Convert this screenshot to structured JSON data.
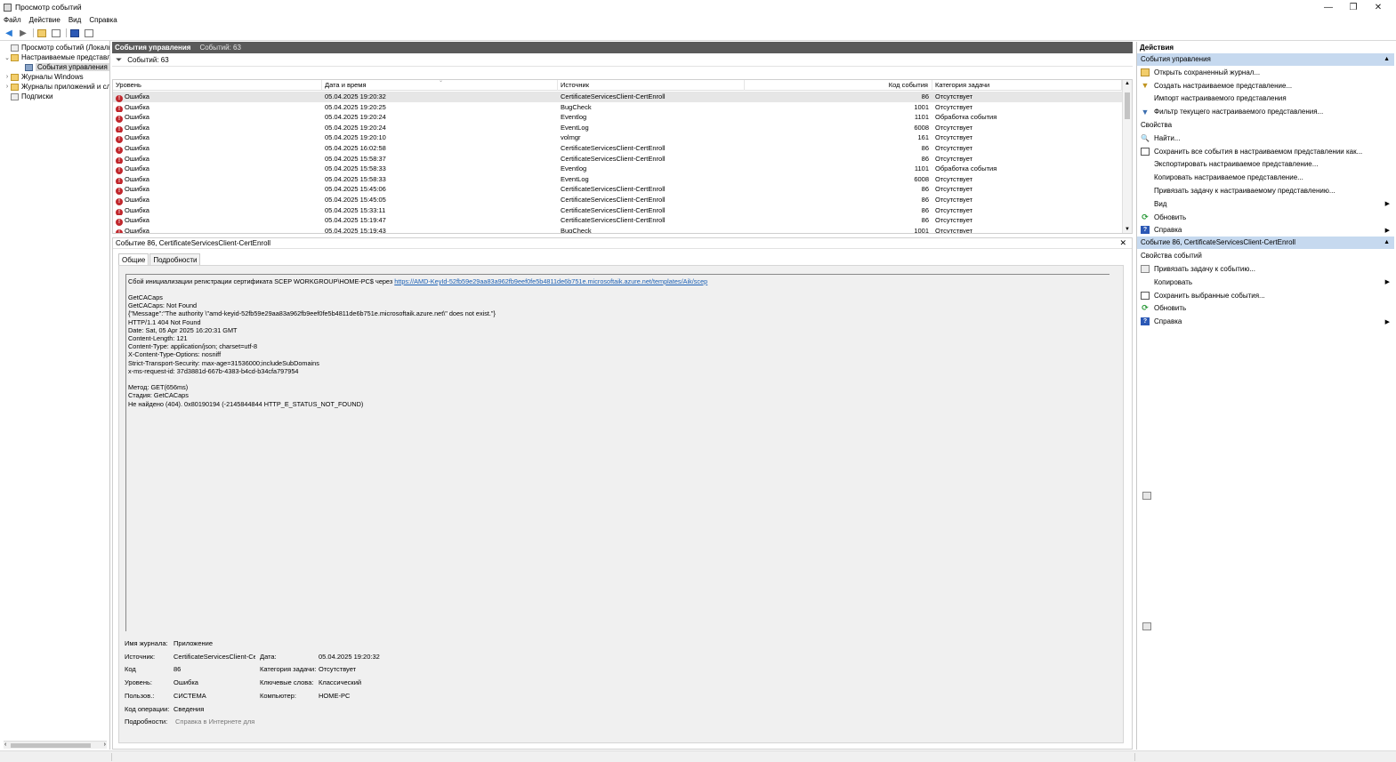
{
  "window": {
    "title": "Просмотр событий",
    "controls": [
      "—",
      "❐",
      "✕"
    ]
  },
  "menu": [
    "Файл",
    "Действие",
    "Вид",
    "Справка"
  ],
  "tree": {
    "items": [
      {
        "label": "Просмотр событий (Локальный)",
        "expander": "",
        "icon": "event-viewer-icon"
      },
      {
        "label": "Настраиваемые представления",
        "expander": "⌄",
        "icon": "folder-icon"
      },
      {
        "label": "События управления",
        "expander": "",
        "icon": "filter-icon"
      },
      {
        "label": "Журналы Windows",
        "expander": "›",
        "icon": "folder-icon"
      },
      {
        "label": "Журналы приложений и служб",
        "expander": "›",
        "icon": "folder-icon"
      },
      {
        "label": "Подписки",
        "expander": "",
        "icon": "subscriptions-icon"
      }
    ]
  },
  "center": {
    "header_title": "События управления",
    "header_count": "Событий: 63",
    "filter_text": "Событий: 63",
    "columns": {
      "level": "Уровень",
      "datetime": "Дата и время",
      "source": "Источник",
      "code": "Код события",
      "category": "Категория задачи"
    },
    "rows": [
      {
        "level": "Ошибка",
        "datetime": "05.04.2025 19:20:32",
        "source": "CertificateServicesClient-CertEnroll",
        "code": "86",
        "category": "Отсутствует"
      },
      {
        "level": "Ошибка",
        "datetime": "05.04.2025 19:20:25",
        "source": "BugCheck",
        "code": "1001",
        "category": "Отсутствует"
      },
      {
        "level": "Ошибка",
        "datetime": "05.04.2025 19:20:24",
        "source": "Eventlog",
        "code": "1101",
        "category": "Обработка события"
      },
      {
        "level": "Ошибка",
        "datetime": "05.04.2025 19:20:24",
        "source": "EventLog",
        "code": "6008",
        "category": "Отсутствует"
      },
      {
        "level": "Ошибка",
        "datetime": "05.04.2025 19:20:10",
        "source": "volmgr",
        "code": "161",
        "category": "Отсутствует"
      },
      {
        "level": "Ошибка",
        "datetime": "05.04.2025 16:02:58",
        "source": "CertificateServicesClient-CertEnroll",
        "code": "86",
        "category": "Отсутствует"
      },
      {
        "level": "Ошибка",
        "datetime": "05.04.2025 15:58:37",
        "source": "CertificateServicesClient-CertEnroll",
        "code": "86",
        "category": "Отсутствует"
      },
      {
        "level": "Ошибка",
        "datetime": "05.04.2025 15:58:33",
        "source": "Eventlog",
        "code": "1101",
        "category": "Обработка события"
      },
      {
        "level": "Ошибка",
        "datetime": "05.04.2025 15:58:33",
        "source": "EventLog",
        "code": "6008",
        "category": "Отсутствует"
      },
      {
        "level": "Ошибка",
        "datetime": "05.04.2025 15:45:06",
        "source": "CertificateServicesClient-CertEnroll",
        "code": "86",
        "category": "Отсутствует"
      },
      {
        "level": "Ошибка",
        "datetime": "05.04.2025 15:45:05",
        "source": "CertificateServicesClient-CertEnroll",
        "code": "86",
        "category": "Отсутствует"
      },
      {
        "level": "Ошибка",
        "datetime": "05.04.2025 15:33:11",
        "source": "CertificateServicesClient-CertEnroll",
        "code": "86",
        "category": "Отсутствует"
      },
      {
        "level": "Ошибка",
        "datetime": "05.04.2025 15:19:47",
        "source": "CertificateServicesClient-CertEnroll",
        "code": "86",
        "category": "Отсутствует"
      },
      {
        "level": "Ошибка",
        "datetime": "05.04.2025 15:19:43",
        "source": "BugCheck",
        "code": "1001",
        "category": "Отсутствует"
      }
    ]
  },
  "detail": {
    "title": "Событие 86, CertificateServicesClient-CertEnroll",
    "tabs": [
      "Общие",
      "Подробности"
    ],
    "message_first": "Сбой инициализации регистрации сертификата SCEP WORKGROUP\\HOME-PC$ через",
    "message_link": "https://AMD-KeyId-52fb59e29aa83a962fb9eef0fe5b4811de6b751e.microsoftaik.azure.net/templates/Aik/scep",
    "message_lines": [
      "GetCACaps",
      "GetCACaps: Not Found",
      "{\"Message\":\"The authority \\\"amd-keyid-52fb59e29aa83a962fb9eef0fe5b4811de6b751e.microsoftaik.azure.net\\\" does not exist.\"}",
      "HTTP/1.1 404 Not Found",
      "Date: Sat, 05 Apr 2025 16:20:31 GMT",
      "Content-Length: 121",
      "Content-Type: application/json; charset=utf-8",
      "X-Content-Type-Options: nosniff",
      "Strict-Transport-Security: max-age=31536000;includeSubDomains",
      "x-ms-request-id: 37d3881d-667b-4383-b4cd-b34cfa797954",
      "",
      "Метод: GET(656ms)",
      "Стадия: GetCACaps",
      "Не найдено (404). 0x80190194 (-2145844844 HTTP_E_STATUS_NOT_FOUND)"
    ],
    "props": {
      "log_label": "Имя журнала:",
      "log_value": "Приложение",
      "source_label": "Источник:",
      "source_value": "CertificateServicesClient-Cer",
      "date_label": "Дата:",
      "date_value": "05.04.2025 19:20:32",
      "code_label": "Код",
      "code_value": "86",
      "task_label": "Категория задачи:",
      "task_value": "Отсутствует",
      "levels_label": "Уровень:",
      "levels_value": "Ошибка",
      "keywords_label": "Ключевые слова:",
      "keywords_value": "Классический",
      "user_label": "Пользов.:",
      "user_value": "СИСТЕМА",
      "computer_label": "Компьютер:",
      "computer_value": "HOME-PC",
      "opcode_label": "Код операции:",
      "opcode_value": "Сведения",
      "more_label": "Подробности:",
      "more_value": "Справка в Интернете для"
    }
  },
  "actions": {
    "header": "Действия",
    "section1": "События управления",
    "items1": [
      {
        "label": "Открыть сохраненный журнал...",
        "icon": "open-log-icon",
        "sub": false
      },
      {
        "label": "Создать настраиваемое представление...",
        "icon": "create-filter-icon",
        "sub": false
      },
      {
        "label": "Импорт настраиваемого представления",
        "icon": "",
        "sub": false
      },
      {
        "label": "Фильтр текущего настраиваемого представления...",
        "icon": "filter-icon",
        "sub": false
      },
      {
        "label": "Свойства",
        "icon": "properties-icon",
        "sub": false
      },
      {
        "label": "Найти...",
        "icon": "find-icon",
        "sub": false
      },
      {
        "label": "Сохранить все события в настраиваемом представлении как...",
        "icon": "save-icon",
        "sub": false
      },
      {
        "label": "Экспортировать настраиваемое представление...",
        "icon": "",
        "sub": false
      },
      {
        "label": "Копировать настраиваемое представление...",
        "icon": "",
        "sub": false
      },
      {
        "label": "Привязать задачу к настраиваемому представлению...",
        "icon": "",
        "sub": false
      },
      {
        "label": "Вид",
        "icon": "",
        "sub": true
      },
      {
        "label": "Обновить",
        "icon": "refresh-icon",
        "sub": false
      },
      {
        "label": "Справка",
        "icon": "help-icon",
        "sub": true
      }
    ],
    "section2": "Событие 86, CertificateServicesClient-CertEnroll",
    "items2": [
      {
        "label": "Свойства событий",
        "icon": "event-properties-icon",
        "sub": false
      },
      {
        "label": "Привязать задачу к событию...",
        "icon": "attach-task-icon",
        "sub": false
      },
      {
        "label": "Копировать",
        "icon": "",
        "sub": true
      },
      {
        "label": "Сохранить выбранные события...",
        "icon": "save-icon",
        "sub": false
      },
      {
        "label": "Обновить",
        "icon": "refresh-icon",
        "sub": false
      },
      {
        "label": "Справка",
        "icon": "help-icon",
        "sub": true
      }
    ]
  }
}
